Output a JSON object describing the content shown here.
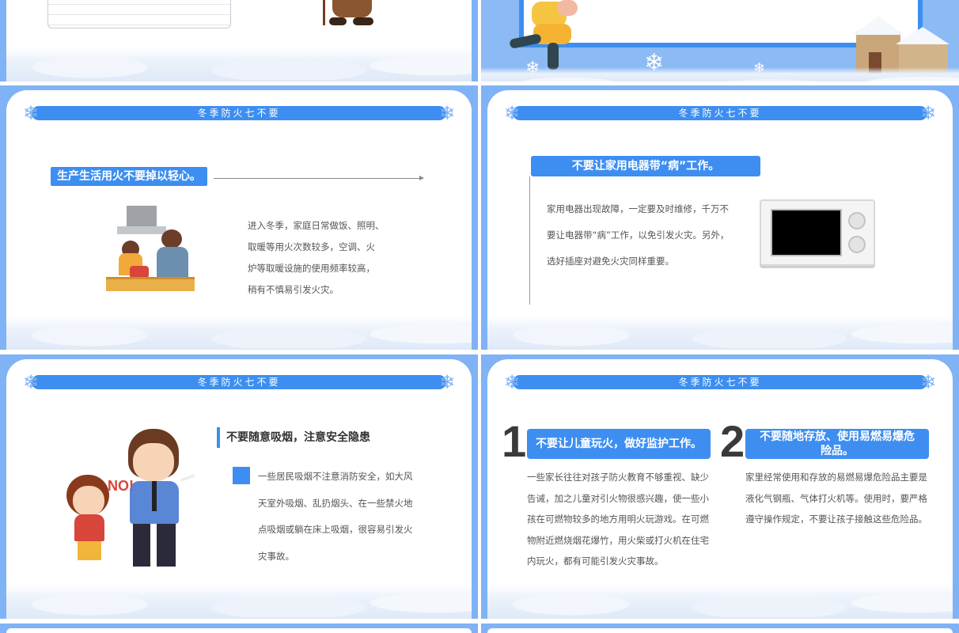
{
  "colors": {
    "accent": "#3d8ef0",
    "frame": "#7fb3f5",
    "text": "#555555"
  },
  "banner_title": "冬季防火七不要",
  "slide_a": {
    "heading": "生产生活用火不要掉以轻心。",
    "lines": [
      "进入冬季，家庭日常做饭、照明、",
      "取暖等用火次数较多，空调、火",
      "炉等取暖设施的使用频率较高，",
      "稍有不慎易引发火灾。"
    ],
    "illustration_icon": "kitchen-cooking-illustration"
  },
  "slide_b": {
    "heading": "不要让家用电器带“病”工作。",
    "lines": [
      "家用电器出现故障，一定要及时维修，千万不",
      "要让电器带“病”工作，以免引发火灾。另外，",
      "选好插座对避免火灾同样重要。"
    ],
    "illustration_icon": "microwave-oven-icon"
  },
  "slide_c": {
    "heading": "不要随意吸烟，注意安全隐患",
    "lines": [
      "一些居民吸烟不注意消防安全，如大风",
      "天室外吸烟、乱扔烟头、在一些禁火地",
      "点吸烟或躺在床上吸烟，很容易引发火",
      "灾事故。"
    ],
    "no_sign": "NO!",
    "illustration_icon": "smoking-man-and-girl-illustration"
  },
  "slide_d": {
    "item1": {
      "number": "1",
      "heading": "不要让儿童玩火，做好监护工作。",
      "lines": [
        "一些家长往往对孩子防火教育不够重视、缺少",
        "告诫，加之儿童对引火物很感兴趣，使一些小",
        "孩在可燃物较多的地方用明火玩游戏。在可燃",
        "物附近燃烧烟花爆竹，用火柴或打火机在住宅",
        "内玩火，都有可能引发火灾事故。"
      ]
    },
    "item2": {
      "number": "2",
      "heading_lines": [
        "不要随地存放、使用易燃易爆危",
        "险品。"
      ],
      "lines": [
        "家里经常使用和存放的易燃易爆危险品主要是",
        "液化气钢瓶、气体打火机等。使用时，要严格",
        "遵守操作规定，不要让孩子接触这些危险品。"
      ]
    }
  }
}
